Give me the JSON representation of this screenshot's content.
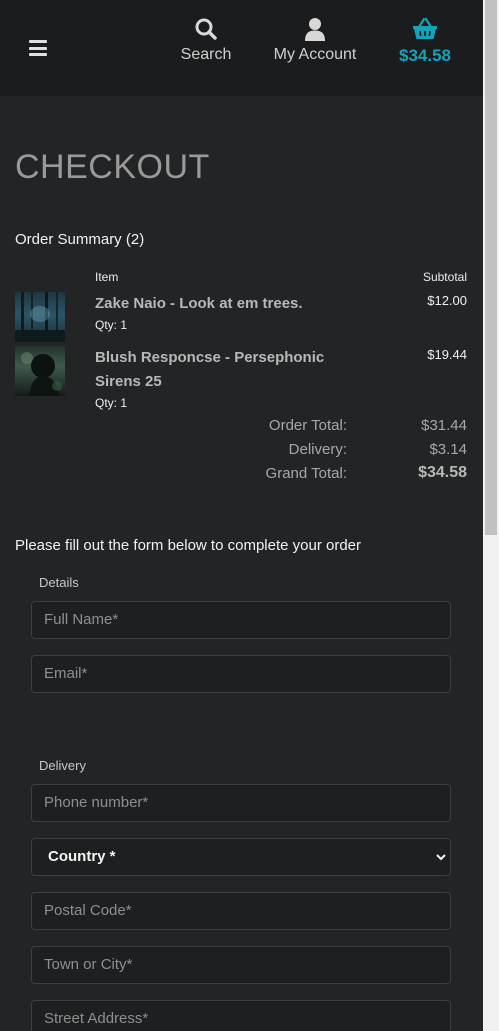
{
  "header": {
    "search_label": "Search",
    "account_label": "My Account",
    "cart_total": "$34.58",
    "icons": {
      "menu": "menu-icon",
      "search": "search-icon",
      "account": "user-icon",
      "cart": "basket-icon"
    },
    "accent_color": "#17a2b8"
  },
  "page": {
    "title": "CHECKOUT",
    "summary_title": "Order Summary (2)",
    "col_item": "Item",
    "col_subtotal": "Subtotal"
  },
  "items": [
    {
      "name": "Zake Naio - Look at em trees.",
      "qty": "Qty: 1",
      "price": "$12.00"
    },
    {
      "name": "Blush Responcse - Persephonic Sirens 25",
      "qty": "Qty: 1",
      "price": "$19.44"
    }
  ],
  "totals": {
    "order_total_label": "Order Total:",
    "order_total": "$31.44",
    "delivery_label": "Delivery:",
    "delivery": "$3.14",
    "grand_total_label": "Grand Total:",
    "grand_total": "$34.58"
  },
  "form": {
    "intro": "Please fill out the form below to complete your order",
    "details_label": "Details",
    "full_name_placeholder": "Full Name*",
    "email_placeholder": "Email*",
    "delivery_label": "Delivery",
    "phone_placeholder": "Phone number*",
    "country_selected": "Country *",
    "postal_placeholder": "Postal Code*",
    "town_placeholder": "Town or City*",
    "street_placeholder": "Street Address*"
  }
}
